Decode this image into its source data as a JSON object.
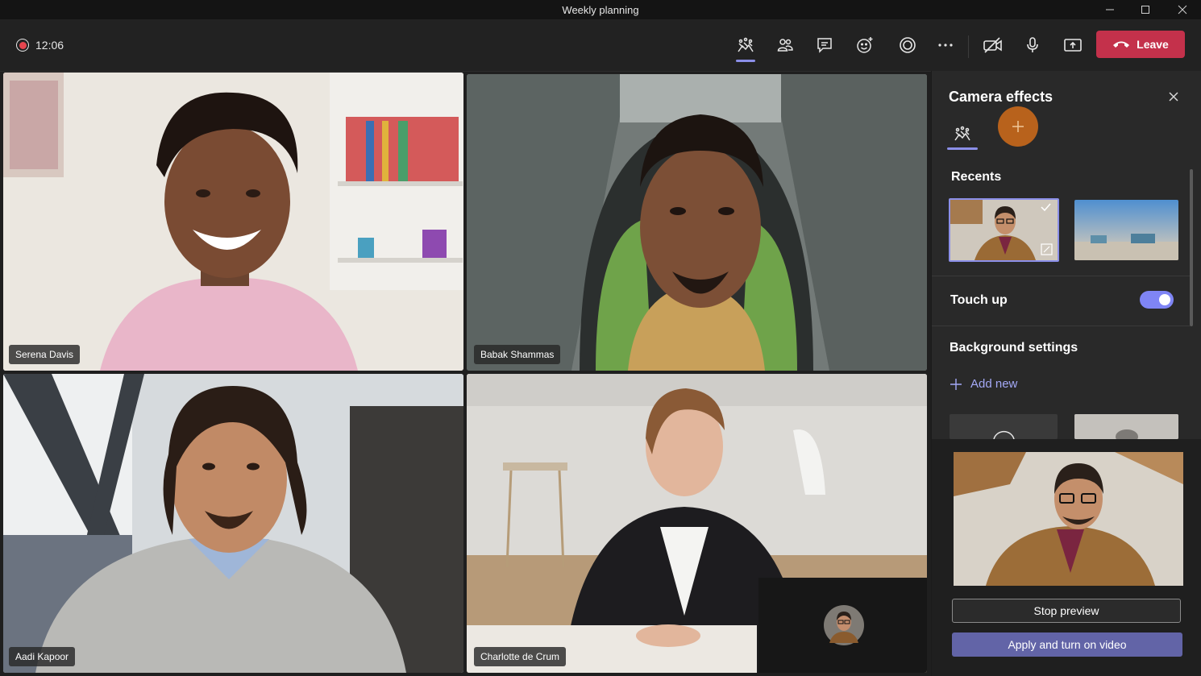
{
  "window": {
    "title": "Weekly planning"
  },
  "toolbar": {
    "timer": "12:06",
    "leave_label": "Leave",
    "icons": [
      "camera-effects-icon",
      "people-icon",
      "chat-icon",
      "reactions-icon",
      "record-icon",
      "more-icon",
      "camera-off-icon",
      "mic-icon",
      "share-icon"
    ]
  },
  "participants": [
    {
      "name": "Serena Davis"
    },
    {
      "name": "Babak Shammas"
    },
    {
      "name": "Aadi Kapoor"
    },
    {
      "name": "Charlotte de Crum"
    }
  ],
  "panel": {
    "title": "Camera effects",
    "recents_label": "Recents",
    "touchup_label": "Touch up",
    "touchup_on": true,
    "bg_settings_label": "Background settings",
    "add_new_label": "Add new",
    "stop_preview_label": "Stop preview",
    "apply_label": "Apply and turn on video"
  },
  "colors": {
    "accent": "#7f85f5",
    "leave": "#c4314b",
    "apply": "#6264a7",
    "add_effect": "#b8621c"
  }
}
